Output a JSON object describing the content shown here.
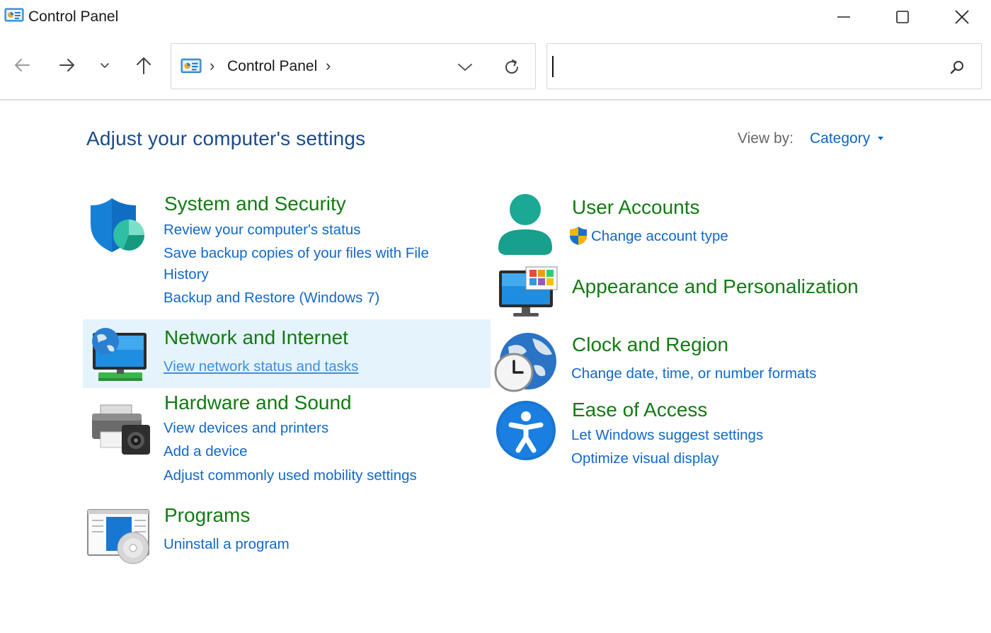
{
  "window": {
    "title": "Control Panel"
  },
  "address": {
    "crumb": "Control Panel"
  },
  "search": {
    "value": ""
  },
  "header": {
    "title": "Adjust your computer's settings",
    "view_by_label": "View by:",
    "view_by_value": "Category"
  },
  "colors": {
    "title_blue": "#1a4b8c",
    "category_green": "#137a13",
    "link_blue": "#1268c9",
    "highlight": "#e5f3fd"
  },
  "categories": {
    "system": {
      "title": "System and Security",
      "links": [
        "Review your computer's status",
        "Save backup copies of your files with File",
        "History",
        "Backup and Restore (Windows 7)"
      ]
    },
    "network": {
      "title": "Network and Internet",
      "links": [
        "View network status and tasks"
      ]
    },
    "hardware": {
      "title": "Hardware and Sound",
      "links": [
        "View devices and printers",
        "Add a device",
        "Adjust commonly used mobility settings"
      ]
    },
    "programs": {
      "title": "Programs",
      "links": [
        "Uninstall a program"
      ]
    },
    "users": {
      "title": "User Accounts",
      "links": [
        "Change account type"
      ]
    },
    "appearance": {
      "title": "Appearance and Personalization",
      "links": []
    },
    "clock": {
      "title": "Clock and Region",
      "links": [
        "Change date, time, or number formats"
      ]
    },
    "ease": {
      "title": "Ease of Access",
      "links": [
        "Let Windows suggest settings",
        "Optimize visual display"
      ]
    }
  },
  "icons": {
    "app": "control-panel-icon",
    "back": "arrow-left-icon",
    "forward": "arrow-right-icon",
    "recent": "chevron-down-icon",
    "up": "arrow-up-icon",
    "refresh": "refresh-icon",
    "search": "search-icon",
    "minimize": "minimize-icon",
    "maximize": "maximize-icon",
    "close": "close-icon"
  }
}
